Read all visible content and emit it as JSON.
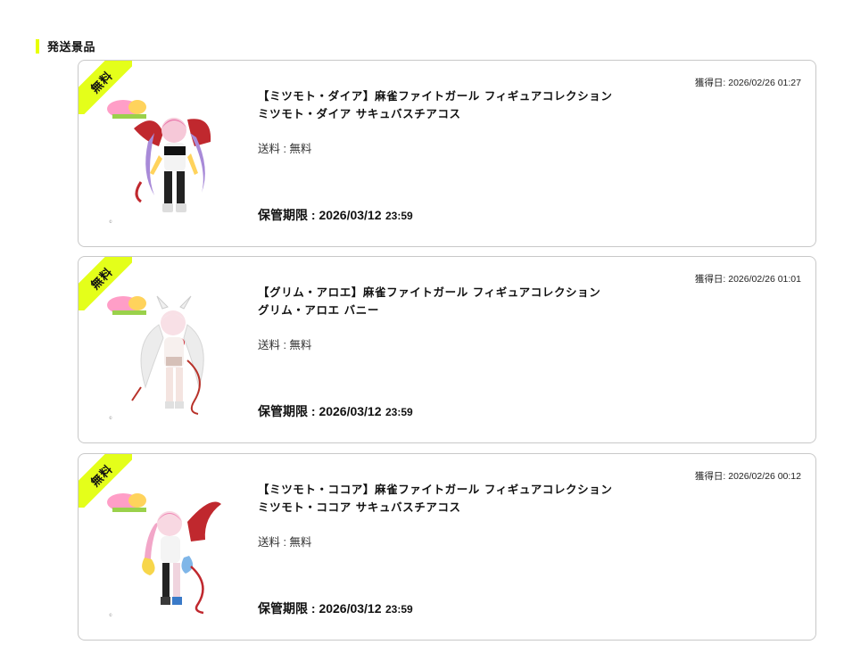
{
  "section": {
    "title": "発送景品"
  },
  "colors": {
    "accent": "#e4ff1a",
    "border": "#c8c8c8"
  },
  "prizes": [
    {
      "ribbon": "無料",
      "acquired": "獲得日: 2026/02/26 01:27",
      "title": "【ミツモト・ダイア】麻雀ファイトガール フィギュアコレクション ミツモト・ダイア サキュバスチアコス",
      "shipping": "送料 : 無料",
      "expiry_label": "保管期限 : 2026/03/12",
      "expiry_time": "23:59",
      "image_icon": "figure-image-dia"
    },
    {
      "ribbon": "無料",
      "acquired": "獲得日: 2026/02/26 01:01",
      "title": "【グリム・アロエ】麻雀ファイトガール フィギュアコレクション グリム・アロエ バニー",
      "shipping": "送料 : 無料",
      "expiry_label": "保管期限 : 2026/03/12",
      "expiry_time": "23:59",
      "image_icon": "figure-image-aloe"
    },
    {
      "ribbon": "無料",
      "acquired": "獲得日: 2026/02/26 00:12",
      "title": "【ミツモト・ココア】麻雀ファイトガール フィギュアコレクション ミツモト・ココア サキュバスチアコス",
      "shipping": "送料 : 無料",
      "expiry_label": "保管期限 : 2026/03/12",
      "expiry_time": "23:59",
      "image_icon": "figure-image-cocoa"
    }
  ]
}
